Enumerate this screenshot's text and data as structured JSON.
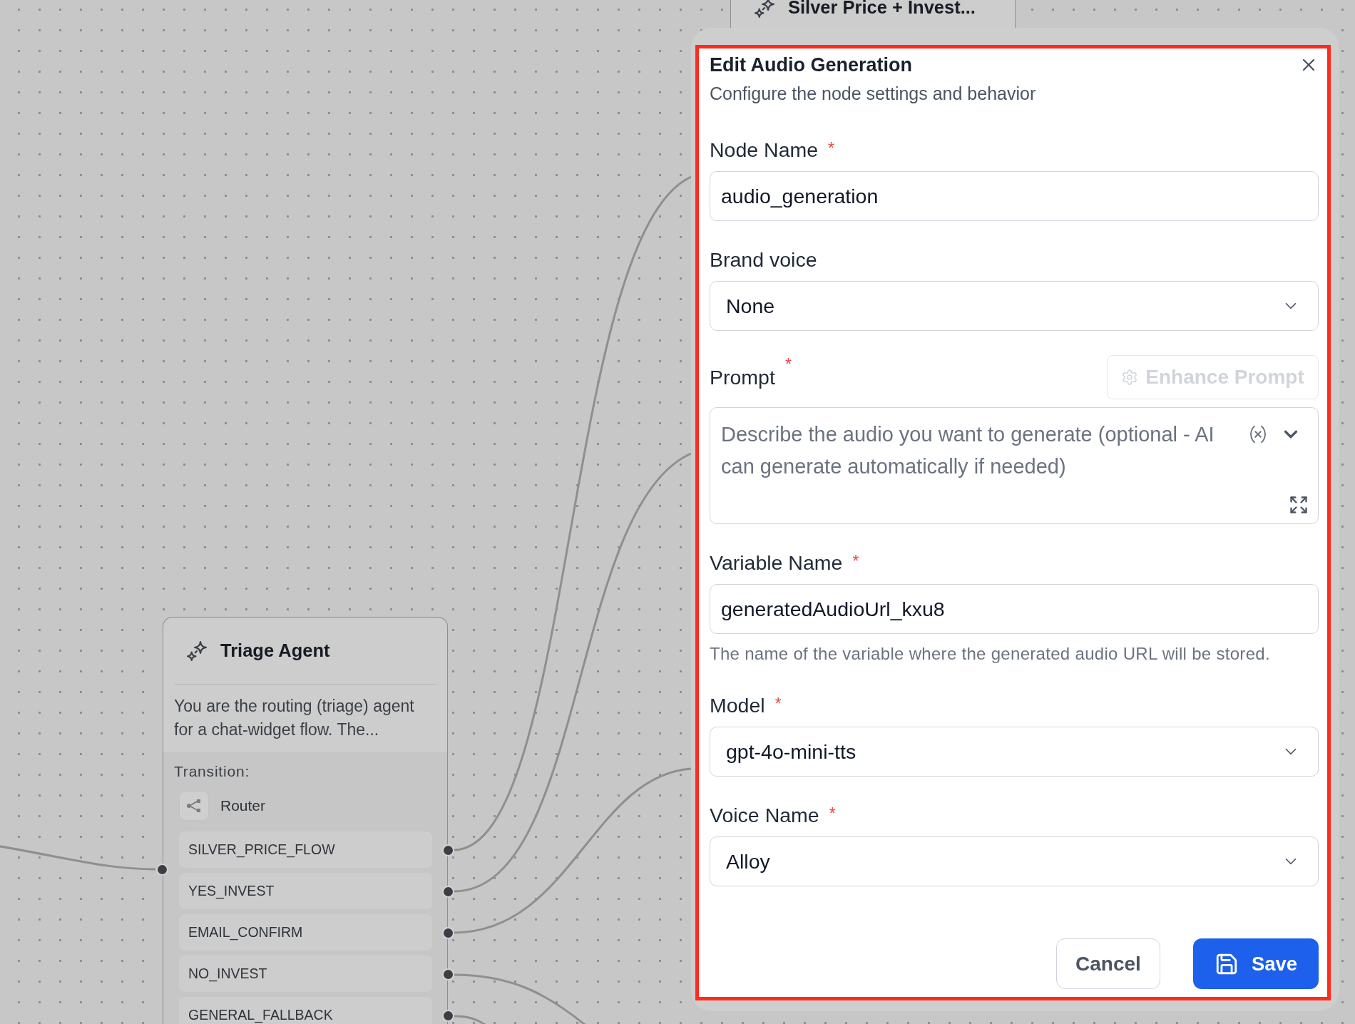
{
  "canvas": {
    "nodes": [
      {
        "kind": "agent",
        "title": "Silver Price + Invest..."
      },
      {
        "kind": "agent",
        "title": "Triage Agent",
        "description": "You are the routing (triage) agent for a chat-widget flow. The...",
        "transition": {
          "label": "Transition:",
          "type": "Router"
        },
        "routes": [
          "SILVER_PRICE_FLOW",
          "YES_INVEST",
          "EMAIL_CONFIRM",
          "NO_INVEST",
          "GENERAL_FALLBACK"
        ]
      }
    ]
  },
  "dialog": {
    "title": "Edit Audio Generation",
    "subtitle": "Configure the node settings and behavior",
    "fields": [
      {
        "kind": "text",
        "label": "Node Name",
        "required_mark": "*",
        "value": "audio_generation"
      },
      {
        "kind": "select",
        "label": "Brand voice",
        "value": "None"
      },
      {
        "kind": "textarea",
        "label": "Prompt",
        "required_mark": "*",
        "action": {
          "label": "Enhance Prompt",
          "disabled": true
        },
        "placeholder": "Describe the audio you want to generate (optional - AI can generate automatically if needed)"
      },
      {
        "kind": "text",
        "label": "Variable Name",
        "required_mark": "*",
        "value": "generatedAudioUrl_kxu8",
        "help": "The name of the variable where the generated audio URL will be stored."
      },
      {
        "kind": "select",
        "label": "Model",
        "required_mark": "*",
        "value": "gpt-4o-mini-tts"
      },
      {
        "kind": "select",
        "label": "Voice Name",
        "required_mark": "*",
        "value": "Alloy"
      }
    ],
    "buttons": [
      {
        "kind": "cancel",
        "label": "Cancel"
      },
      {
        "kind": "save",
        "label": "Save"
      }
    ]
  }
}
